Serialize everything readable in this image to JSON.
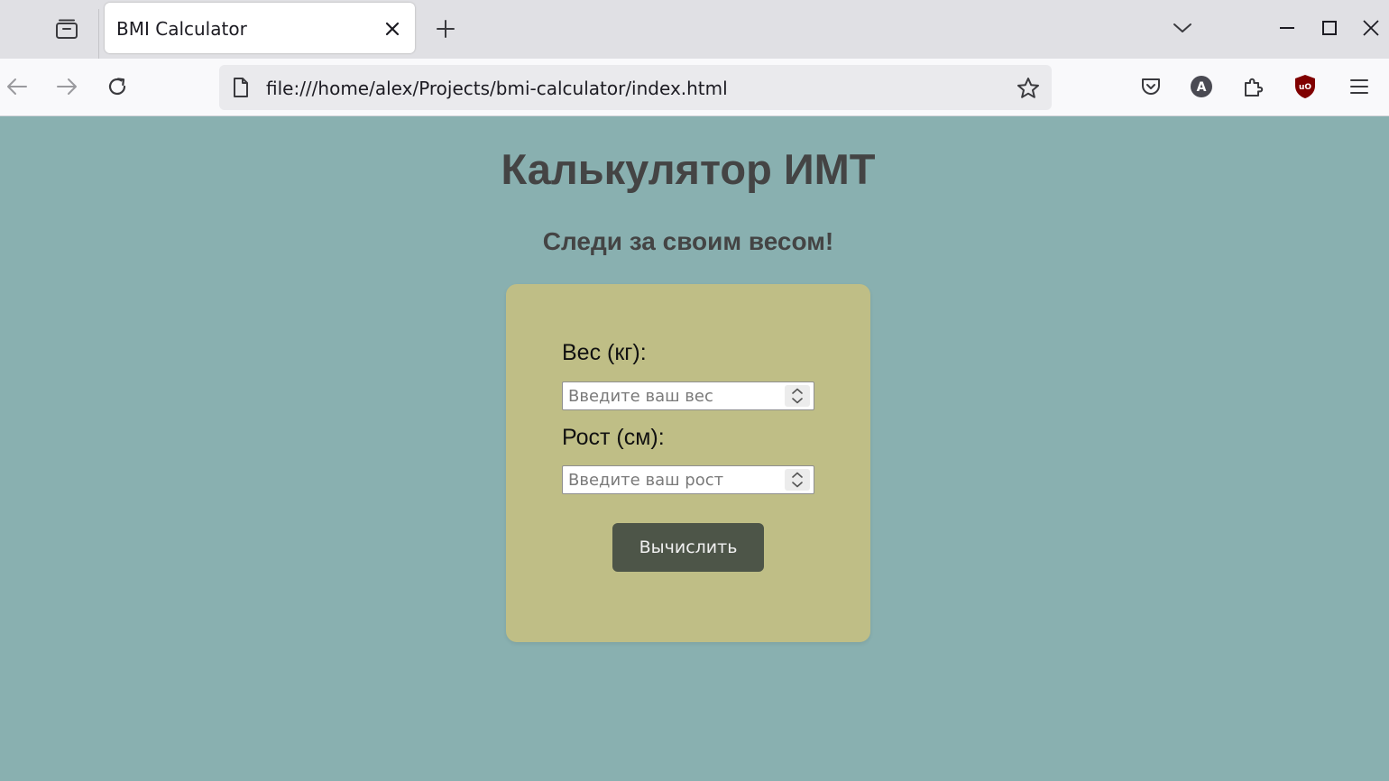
{
  "browser": {
    "tab": {
      "title": "BMI Calculator"
    },
    "url": "file:///home/alex/Projects/bmi-calculator/index.html",
    "icons": {
      "tab_list": "tab-list-icon",
      "close_tab": "close-icon",
      "new_tab": "plus-icon",
      "list_all_tabs": "chevron-down-icon",
      "back": "arrow-left-icon",
      "forward": "arrow-right-icon",
      "reload": "reload-icon",
      "page": "page-icon",
      "bookmark": "star-icon",
      "pocket": "pocket-icon",
      "account": "account-icon",
      "extensions": "puzzle-icon",
      "ublock": "ublock-shield-icon",
      "menu": "hamburger-menu-icon",
      "minimize": "minimize-icon",
      "maximize": "maximize-icon",
      "close_window": "close-icon"
    },
    "account_letter": "A",
    "ublock_label": "uO"
  },
  "page": {
    "background_color": "#89b0b0",
    "title": "Калькулятор ИМТ",
    "subtitle": "Следи за своим весом!",
    "form": {
      "background_color": "#bfbe86",
      "weight": {
        "label": "Вес (кг):",
        "value": "",
        "placeholder": "Введите ваш вес"
      },
      "height": {
        "label": "Рост (см):",
        "value": "",
        "placeholder": "Введите ваш рост"
      },
      "submit_label": "Вычислить",
      "button_color": "#4d5548"
    }
  }
}
